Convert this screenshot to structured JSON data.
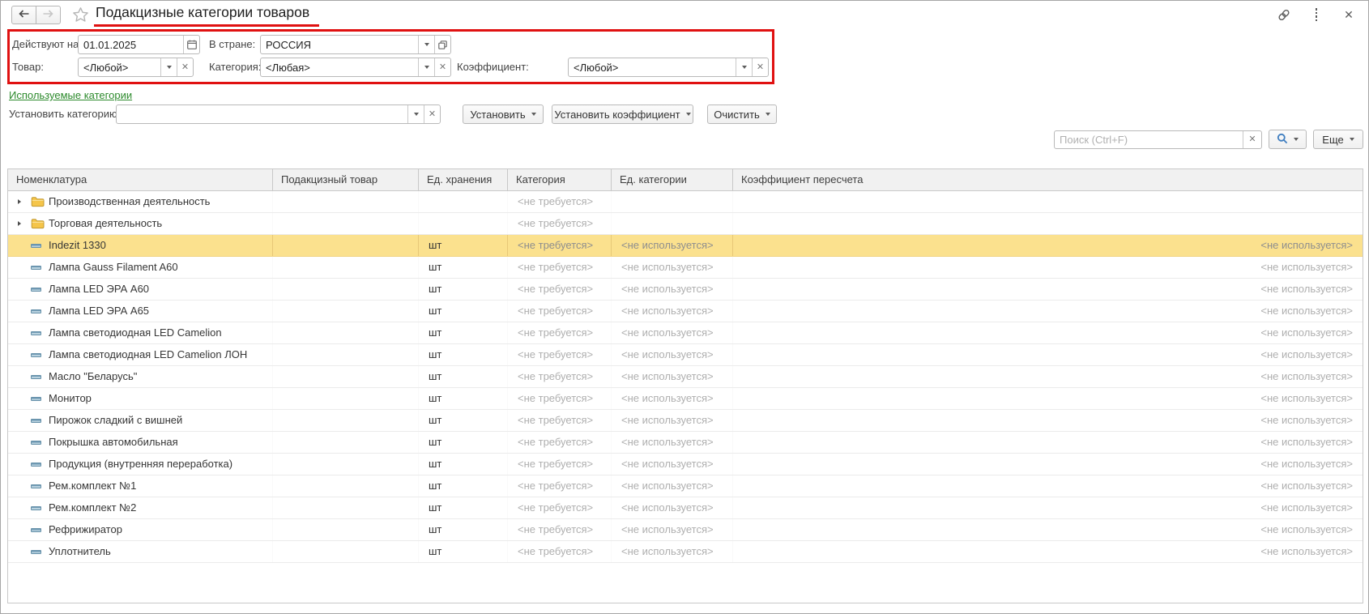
{
  "window": {
    "title": "Подакцизные категории товаров"
  },
  "icons": [
    "back-arrow-icon",
    "forward-arrow-icon",
    "favorites-star-icon",
    "link-icon",
    "more-menu-dots-icon",
    "close-icon",
    "calendar-icon",
    "dropdown-arrow-icon",
    "clear-x-icon",
    "open-picker-icon",
    "search-magnifier-icon",
    "folder-icon",
    "item-dash-icon",
    "expand-triangle-icon"
  ],
  "filters": {
    "date_label": "Действуют на:",
    "date_value": "01.01.2025",
    "country_label": "В стране:",
    "country_value": "РОССИЯ",
    "product_label": "Товар:",
    "product_value": "<Любой>",
    "category_label": "Категория:",
    "category_value": "<Любая>",
    "coefficient_label": "Коэффициент:",
    "coefficient_value": "<Любой>"
  },
  "used_categories_link": "Используемые категории",
  "set_category": {
    "label": "Установить категорию:",
    "value": ""
  },
  "actions": {
    "set_button": "Установить",
    "set_coefficient_button": "Установить коэффициент",
    "clear_button": "Очистить",
    "more_button": "Еще"
  },
  "search": {
    "placeholder": "Поиск (Ctrl+F)"
  },
  "table": {
    "columns": [
      "Номенклатура",
      "Подакцизный товар",
      "Ед. хранения",
      "Категория",
      "Ед. категории",
      "Коэффициент пересчета"
    ],
    "rows": [
      {
        "type": "group",
        "name": "Производственная деятельность",
        "excise": "",
        "unit": "",
        "category": "<не требуется>",
        "category_unit": "",
        "coefficient": "",
        "selected": false
      },
      {
        "type": "group",
        "name": "Торговая деятельность",
        "excise": "",
        "unit": "",
        "category": "<не требуется>",
        "category_unit": "",
        "coefficient": "",
        "selected": false
      },
      {
        "type": "item",
        "name": "Indezit 1330",
        "excise": "",
        "unit": "шт",
        "category": "<не требуется>",
        "category_unit": "<не используется>",
        "coefficient": "<не используется>",
        "selected": true
      },
      {
        "type": "item",
        "name": "Лампа Gauss Filament A60",
        "excise": "",
        "unit": "шт",
        "category": "<не требуется>",
        "category_unit": "<не используется>",
        "coefficient": "<не используется>",
        "selected": false
      },
      {
        "type": "item",
        "name": "Лампа LED ЭРА А60",
        "excise": "",
        "unit": "шт",
        "category": "<не требуется>",
        "category_unit": "<не используется>",
        "coefficient": "<не используется>",
        "selected": false
      },
      {
        "type": "item",
        "name": "Лампа LED ЭРА А65",
        "excise": "",
        "unit": "шт",
        "category": "<не требуется>",
        "category_unit": "<не используется>",
        "coefficient": "<не используется>",
        "selected": false
      },
      {
        "type": "item",
        "name": "Лампа светодиодная LED Camelion",
        "excise": "",
        "unit": "шт",
        "category": "<не требуется>",
        "category_unit": "<не используется>",
        "coefficient": "<не используется>",
        "selected": false
      },
      {
        "type": "item",
        "name": "Лампа светодиодная LED Camelion ЛОН",
        "excise": "",
        "unit": "шт",
        "category": "<не требуется>",
        "category_unit": "<не используется>",
        "coefficient": "<не используется>",
        "selected": false
      },
      {
        "type": "item",
        "name": "Масло \"Беларусь\"",
        "excise": "",
        "unit": "шт",
        "category": "<не требуется>",
        "category_unit": "<не используется>",
        "coefficient": "<не используется>",
        "selected": false
      },
      {
        "type": "item",
        "name": "Монитор",
        "excise": "",
        "unit": "шт",
        "category": "<не требуется>",
        "category_unit": "<не используется>",
        "coefficient": "<не используется>",
        "selected": false
      },
      {
        "type": "item",
        "name": "Пирожок сладкий с вишней",
        "excise": "",
        "unit": "шт",
        "category": "<не требуется>",
        "category_unit": "<не используется>",
        "coefficient": "<не используется>",
        "selected": false
      },
      {
        "type": "item",
        "name": "Покрышка автомобильная",
        "excise": "",
        "unit": "шт",
        "category": "<не требуется>",
        "category_unit": "<не используется>",
        "coefficient": "<не используется>",
        "selected": false
      },
      {
        "type": "item",
        "name": "Продукция (внутренняя переработка)",
        "excise": "",
        "unit": "шт",
        "category": "<не требуется>",
        "category_unit": "<не используется>",
        "coefficient": "<не используется>",
        "selected": false
      },
      {
        "type": "item",
        "name": "Рем.комплект №1",
        "excise": "",
        "unit": "шт",
        "category": "<не требуется>",
        "category_unit": "<не используется>",
        "coefficient": "<не используется>",
        "selected": false
      },
      {
        "type": "item",
        "name": "Рем.комплект №2",
        "excise": "",
        "unit": "шт",
        "category": "<не требуется>",
        "category_unit": "<не используется>",
        "coefficient": "<не используется>",
        "selected": false
      },
      {
        "type": "item",
        "name": "Рефрижиратор",
        "excise": "",
        "unit": "шт",
        "category": "<не требуется>",
        "category_unit": "<не используется>",
        "coefficient": "<не используется>",
        "selected": false
      },
      {
        "type": "item",
        "name": "Уплотнитель",
        "excise": "",
        "unit": "шт",
        "category": "<не требуется>",
        "category_unit": "<не используется>",
        "coefficient": "<не используется>",
        "selected": false
      }
    ]
  },
  "colors": {
    "annotation_red": "#e01111",
    "link_green": "#2c8a2c",
    "selected_row_yellow": "#fbe18e",
    "magnifier_blue": "#3f7ec0",
    "folder_yellow": "#f5c54a"
  }
}
